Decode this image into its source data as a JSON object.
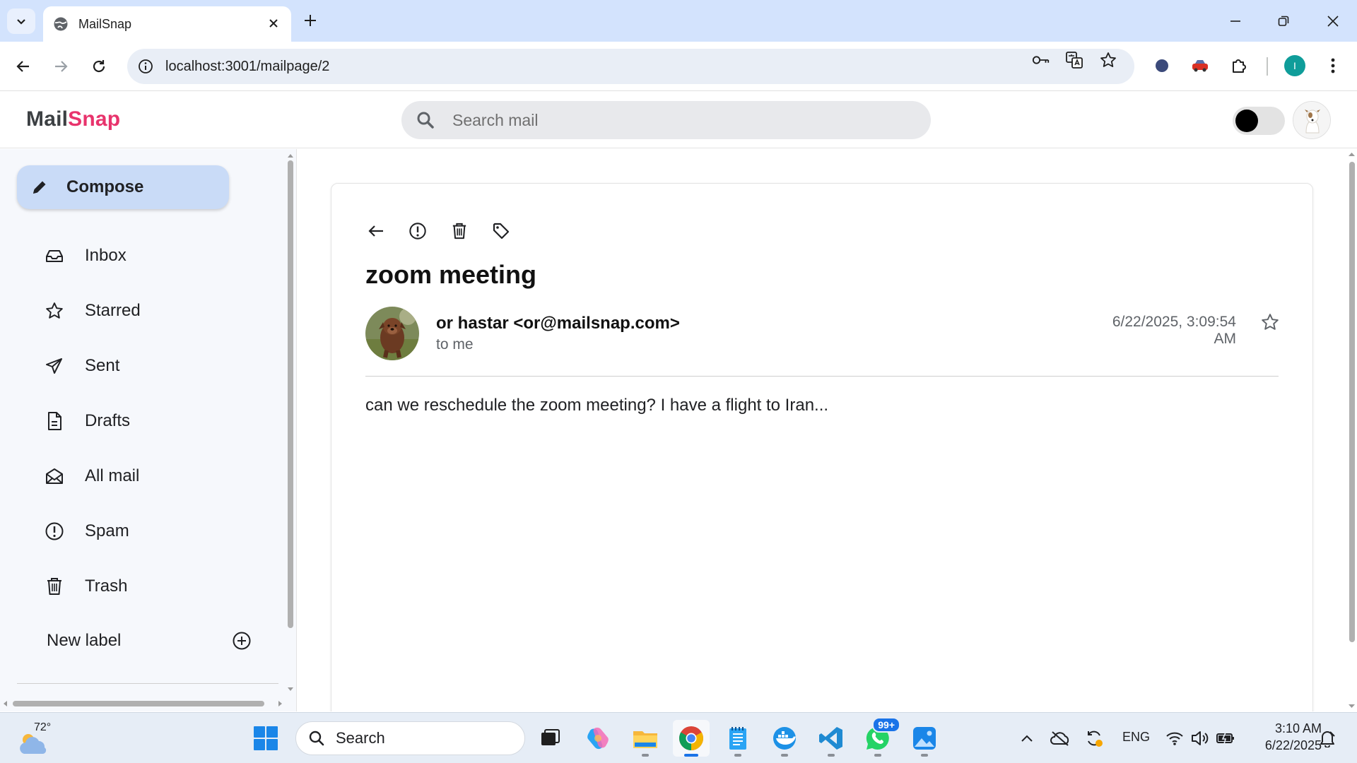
{
  "browser": {
    "tab_title": "MailSnap",
    "url": "localhost:3001/mailpage/2",
    "profile_initial": "I"
  },
  "app": {
    "logo_part1": "Mail",
    "logo_part2": "Snap",
    "search_placeholder": "Search mail",
    "accent_color": "#e8336c"
  },
  "sidebar": {
    "compose_label": "Compose",
    "items": [
      {
        "label": "Inbox",
        "icon": "inbox-icon"
      },
      {
        "label": "Starred",
        "icon": "star-icon"
      },
      {
        "label": "Sent",
        "icon": "send-icon"
      },
      {
        "label": "Drafts",
        "icon": "draft-icon"
      },
      {
        "label": "All mail",
        "icon": "all-mail-icon"
      },
      {
        "label": "Spam",
        "icon": "spam-icon"
      },
      {
        "label": "Trash",
        "icon": "trash-icon"
      }
    ],
    "new_label": "New label"
  },
  "email": {
    "subject": "zoom meeting",
    "sender": "or hastar <or@mailsnap.com>",
    "recipient": "to me",
    "date": "6/22/2025, 3:09:54 AM",
    "body": "can we reschedule the zoom meeting? I have a flight to Iran..."
  },
  "taskbar": {
    "temperature": "72°",
    "search_label": "Search",
    "whatsapp_badge": "99+",
    "language": "ENG",
    "time": "3:10 AM",
    "date": "6/22/2025"
  }
}
